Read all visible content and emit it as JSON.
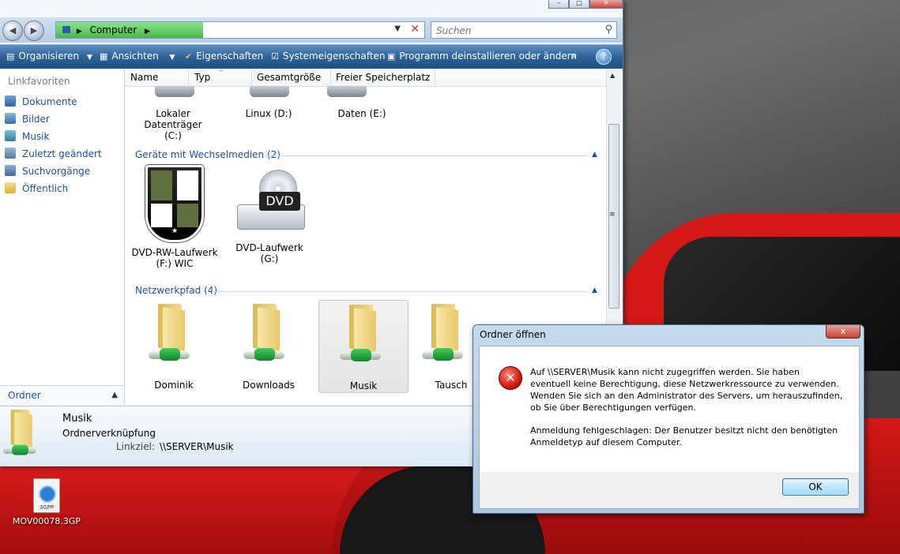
{
  "window": {
    "address": "Computer",
    "search_placeholder": "Suchen"
  },
  "toolbar": {
    "organisieren": "Organisieren",
    "ansichten": "Ansichten",
    "eigenschaften": "Eigenschaften",
    "systemeigenschaften": "Systemeigenschaften",
    "deinstallieren": "Programm deinstallieren oder ändern",
    "more": "»",
    "help": "?"
  },
  "nav": {
    "header": "Linkfavoriten",
    "items": [
      {
        "label": "Dokumente",
        "icon": "documents-icon"
      },
      {
        "label": "Bilder",
        "icon": "pictures-icon"
      },
      {
        "label": "Musik",
        "icon": "music-icon"
      },
      {
        "label": "Zuletzt geändert",
        "icon": "recent-icon"
      },
      {
        "label": "Suchvorgänge",
        "icon": "search-folder-icon"
      },
      {
        "label": "Öffentlich",
        "icon": "folder-icon"
      }
    ],
    "folders_label": "Ordner"
  },
  "columns": [
    "Name",
    "Typ",
    "Gesamtgröße",
    "Freier Speicherplatz"
  ],
  "drives": [
    {
      "label1": "Lokaler Datenträger",
      "label2": "(C:)"
    },
    {
      "label1": "Linux (D:)",
      "label2": ""
    },
    {
      "label1": "Daten (E:)",
      "label2": ""
    }
  ],
  "removable": {
    "header": "Geräte mit Wechselmedien (2)",
    "items": [
      {
        "label1": "DVD-RW-Laufwerk",
        "label2": "(F:) WIC"
      },
      {
        "label1": "DVD-Laufwerk (G:)",
        "label2": ""
      }
    ],
    "dvd_text": "DVD"
  },
  "network": {
    "header": "Netzwerkpfad (4)",
    "items": [
      "Dominik",
      "Downloads",
      "Musik",
      "Tausch"
    ]
  },
  "details": {
    "name": "Musik",
    "type": "Ordnerverknüpfung",
    "target_label": "Linkziel:",
    "target_value": "\\\\SERVER\\Musik"
  },
  "desktop": {
    "file_label": "MOV00078.3GP",
    "file_tag": "3GPP"
  },
  "dialog": {
    "title": "Ordner öffnen",
    "close": "x",
    "message1_lines": [
      "Auf \\\\SERVER\\Musik kann nicht zugegriffen werden. Sie haben",
      "eventuell keine Berechtigung, diese Netzwerkressource zu verwenden.",
      "Wenden Sie sich an den Administrator des Servers, um herauszufinden,",
      "ob Sie über Berechtigungen verfügen."
    ],
    "message2_lines": [
      "Anmeldung fehlgeschlagen: Der Benutzer besitzt nicht den benötigten",
      "Anmeldetyp auf diesem Computer."
    ],
    "ok": "OK"
  }
}
